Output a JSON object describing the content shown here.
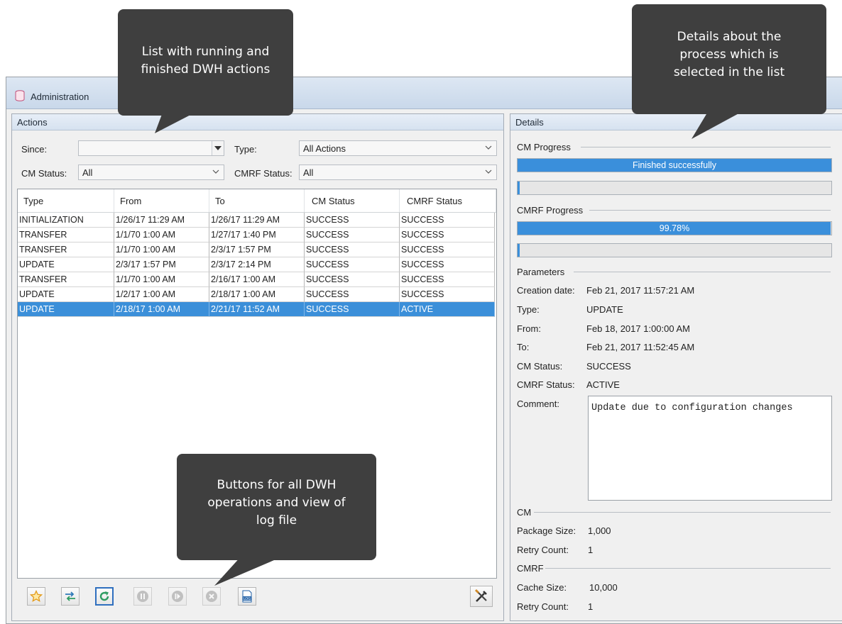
{
  "window": {
    "title": "Administration"
  },
  "actions_panel": {
    "title": "Actions",
    "since_label": "Since:",
    "since_value": "",
    "type_label": "Type:",
    "type_value": "All Actions",
    "cm_status_label": "CM Status:",
    "cm_status_value": "All",
    "cmrf_status_label": "CMRF Status:",
    "cmrf_status_value": "All"
  },
  "table": {
    "columns": [
      "Type",
      "From",
      "To",
      "CM Status",
      "CMRF Status"
    ],
    "rows": [
      [
        "INITIALIZATION",
        "1/26/17 11:29 AM",
        "1/26/17 11:29 AM",
        "SUCCESS",
        "SUCCESS"
      ],
      [
        "TRANSFER",
        "1/1/70 1:00 AM",
        "1/27/17 1:40 PM",
        "SUCCESS",
        "SUCCESS"
      ],
      [
        "TRANSFER",
        "1/1/70 1:00 AM",
        "2/3/17 1:57 PM",
        "SUCCESS",
        "SUCCESS"
      ],
      [
        "UPDATE",
        "2/3/17 1:57 PM",
        "2/3/17 2:14 PM",
        "SUCCESS",
        "SUCCESS"
      ],
      [
        "TRANSFER",
        "1/1/70 1:00 AM",
        "2/16/17 1:00 AM",
        "SUCCESS",
        "SUCCESS"
      ],
      [
        "UPDATE",
        "1/2/17 1:00 AM",
        "2/18/17 1:00 AM",
        "SUCCESS",
        "SUCCESS"
      ],
      [
        "UPDATE",
        "2/18/17 1:00 AM",
        "2/21/17 11:52 AM",
        "SUCCESS",
        "ACTIVE"
      ]
    ],
    "selected_row": 6
  },
  "toolbar": {
    "icons": [
      "star-icon",
      "transfer-icon",
      "refresh-icon",
      "pause-icon",
      "resume-icon",
      "cancel-icon",
      "log-icon",
      "tools-icon"
    ],
    "log_icon_text": "LOG"
  },
  "details_panel": {
    "title": "Details",
    "cm_progress_label": "CM Progress",
    "cm_progress_text": "Finished successfully",
    "cm_progress_value": 1.0,
    "cmrf_progress_label": "CMRF Progress",
    "cmrf_progress_text": "99.78%",
    "cmrf_progress_value": 0.9978,
    "parameters_label": "Parameters",
    "creation_date_label": "Creation date:",
    "creation_date": "Feb 21, 2017 11:57:21 AM",
    "type_label": "Type:",
    "type": "UPDATE",
    "from_label": "From:",
    "from": "Feb 18, 2017 1:00:00 AM",
    "to_label": "To:",
    "to": "Feb 21, 2017 11:52:45 AM",
    "cm_status_label": "CM Status:",
    "cm_status": "SUCCESS",
    "cmrf_status_label": "CMRF Status:",
    "cmrf_status": "ACTIVE",
    "comment_label": "Comment:",
    "comment": "Update due to configuration changes",
    "cm_section_label": "CM",
    "package_size_label": "Package Size:",
    "package_size": "1,000",
    "cm_retry_label": "Retry Count:",
    "cm_retry": "1",
    "cmrf_section_label": "CMRF",
    "cache_size_label": "Cache Size:",
    "cache_size": "10,000",
    "cmrf_retry_label": "Retry Count:",
    "cmrf_retry": "1"
  },
  "callouts": {
    "list": [
      "List with running and",
      "finished DWH actions"
    ],
    "details": [
      "Details about the",
      "process which is",
      "selected in the list"
    ],
    "buttons": [
      "Buttons for all DWH",
      "operations and view of",
      "log file"
    ]
  },
  "colors": {
    "selection": "#3b8fd9",
    "progress": "#3a8fdb",
    "callout": "#3f3f3f"
  }
}
